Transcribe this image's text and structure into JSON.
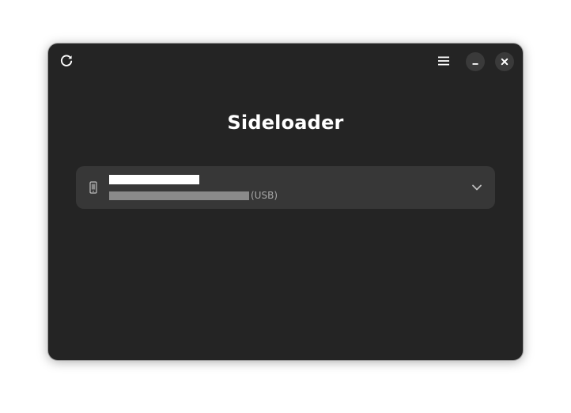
{
  "app": {
    "title": "Sideloader"
  },
  "header": {
    "refresh_icon": "refresh-icon",
    "menu_icon": "hamburger-menu-icon",
    "minimize_icon": "minimize-icon",
    "close_icon": "close-icon"
  },
  "device": {
    "name": "",
    "identifier": "",
    "connection": "(USB)",
    "icon": "phone-icon",
    "expand_icon": "chevron-down-icon"
  },
  "colors": {
    "window_bg": "#242424",
    "row_bg": "#373737",
    "text_primary": "#ffffff",
    "text_secondary": "#a8a8a8"
  }
}
